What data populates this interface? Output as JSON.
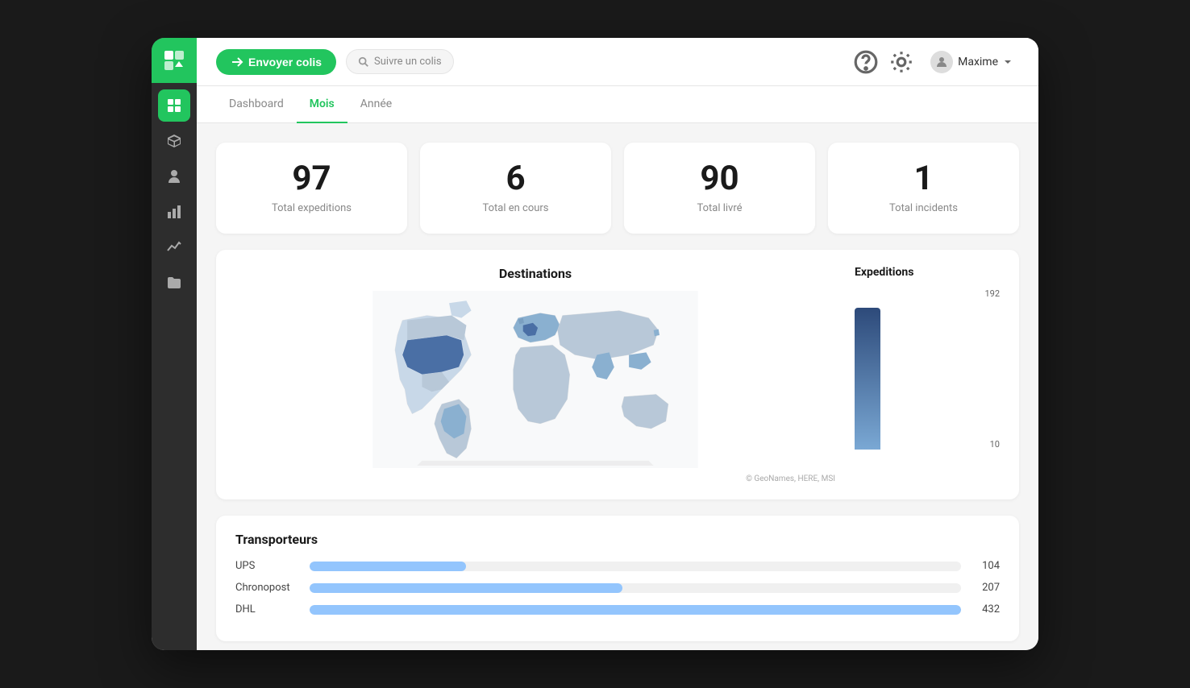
{
  "header": {
    "send_label": "Envoyer colis",
    "search_placeholder": "Suivre un colis",
    "user_name": "Maxime"
  },
  "tabs": [
    {
      "id": "dashboard",
      "label": "Dashboard",
      "active": false
    },
    {
      "id": "mois",
      "label": "Mois",
      "active": true
    },
    {
      "id": "annee",
      "label": "Année",
      "active": false
    }
  ],
  "stats": [
    {
      "id": "expeditions",
      "number": "97",
      "label": "Total expeditions"
    },
    {
      "id": "en_cours",
      "number": "6",
      "label": "Total en cours"
    },
    {
      "id": "livre",
      "number": "90",
      "label": "Total livré"
    },
    {
      "id": "incidents",
      "number": "1",
      "label": "Total incidents"
    }
  ],
  "map": {
    "title": "Destinations",
    "copyright": "© GeoNames, HERE, MSI"
  },
  "expeditions_chart": {
    "title": "Expeditions",
    "bar_top": "192",
    "bar_bottom": "10"
  },
  "transporteurs": {
    "title": "Transporteurs",
    "items": [
      {
        "name": "UPS",
        "count": 104,
        "max": 432
      },
      {
        "name": "Chronopost",
        "count": 207,
        "max": 432
      },
      {
        "name": "DHL",
        "count": 432,
        "max": 432
      }
    ]
  },
  "sidebar": {
    "items": [
      {
        "id": "dashboard",
        "icon": "grid",
        "active": true
      },
      {
        "id": "packages",
        "icon": "box",
        "active": false
      },
      {
        "id": "contacts",
        "icon": "person",
        "active": false
      },
      {
        "id": "stats",
        "icon": "bar-chart",
        "active": false
      },
      {
        "id": "trends",
        "icon": "line-chart",
        "active": false
      },
      {
        "id": "folders",
        "icon": "folder",
        "active": false
      }
    ]
  }
}
